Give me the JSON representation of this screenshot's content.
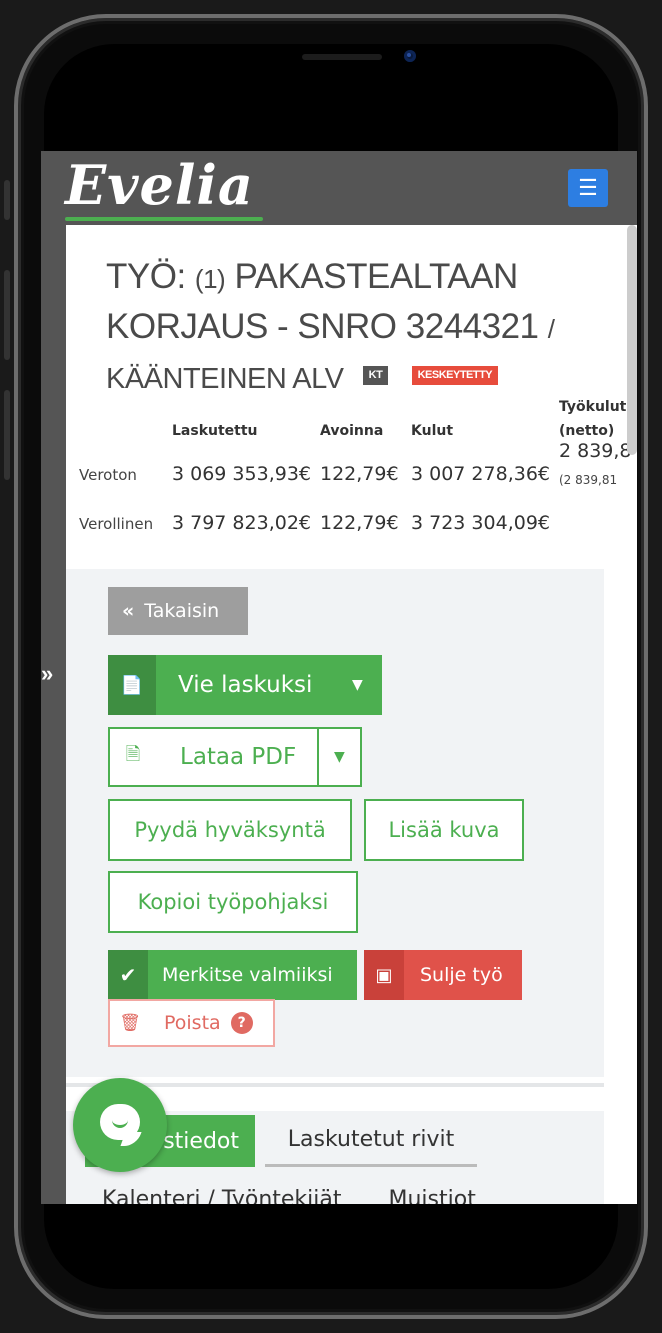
{
  "app": {
    "logo": "Evelia",
    "menu_icon": "hamburger-icon"
  },
  "header": {
    "prefix": "TYÖ:",
    "number": "(1)",
    "title_line1": "PAKASTEALTAAN",
    "title_line2": "KORJAUS - SNRO 3244321",
    "slash": "/",
    "title_line3": "KÄÄNTEINEN ALV",
    "badges": {
      "kt": "KT",
      "status": "KESKEYTETTY"
    }
  },
  "summary": {
    "columns": [
      "Laskutettu",
      "Avoinna",
      "Kulut",
      "Työkulut",
      "(netto)"
    ],
    "rows": [
      {
        "label": "Veroton",
        "laskutettu": "3 069 353,93€",
        "avoinna": "122,79€",
        "kulut": "3 007 278,36€",
        "tyokulut": "2 839,8",
        "tyokulut_sub": "(2 839,81"
      },
      {
        "label": "Verollinen",
        "laskutettu": "3 797 823,02€",
        "avoinna": "122,79€",
        "kulut": "3 723 304,09€"
      }
    ]
  },
  "actions": {
    "back": "Takaisin",
    "export_invoice": "Vie laskuksi",
    "download_pdf": "Lataa PDF",
    "request_approval": "Pyydä hyväksyntä",
    "add_image": "Lisää kuva",
    "copy_template": "Kopioi työpohjaksi",
    "mark_done": "Merkitse valmiiksi",
    "close_job": "Sulje työ",
    "delete": "Poista"
  },
  "tabs": {
    "active": "stiedot",
    "invoiced_rows": "Laskutetut rivit",
    "calendar": "Kalenteri / Työntekijät",
    "notes": "Muistiot"
  },
  "colors": {
    "accent": "#4caf50",
    "danger": "#e74c3c",
    "menu": "#2d7ee2"
  }
}
